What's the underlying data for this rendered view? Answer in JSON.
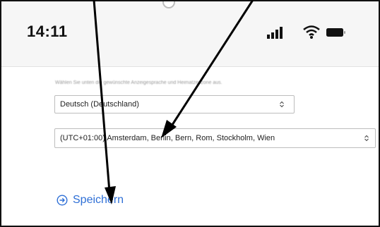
{
  "status_bar": {
    "time": "14:11",
    "icons": [
      "signal-bars-icon",
      "wifi-icon",
      "battery-icon"
    ]
  },
  "form": {
    "hint": "Wählen Sie unten die gewünschte Anzeigesprache und Heimatzeitzone aus.",
    "language_select": {
      "value": "Deutsch (Deutschland)"
    },
    "timezone_select": {
      "value": "(UTC+01:00) Amsterdam, Berlin, Bern, Rom, Stockholm, Wien"
    },
    "save_label": "Speichern"
  },
  "colors": {
    "accent": "#2e6fd6",
    "annotation_arrow": "#000000"
  }
}
